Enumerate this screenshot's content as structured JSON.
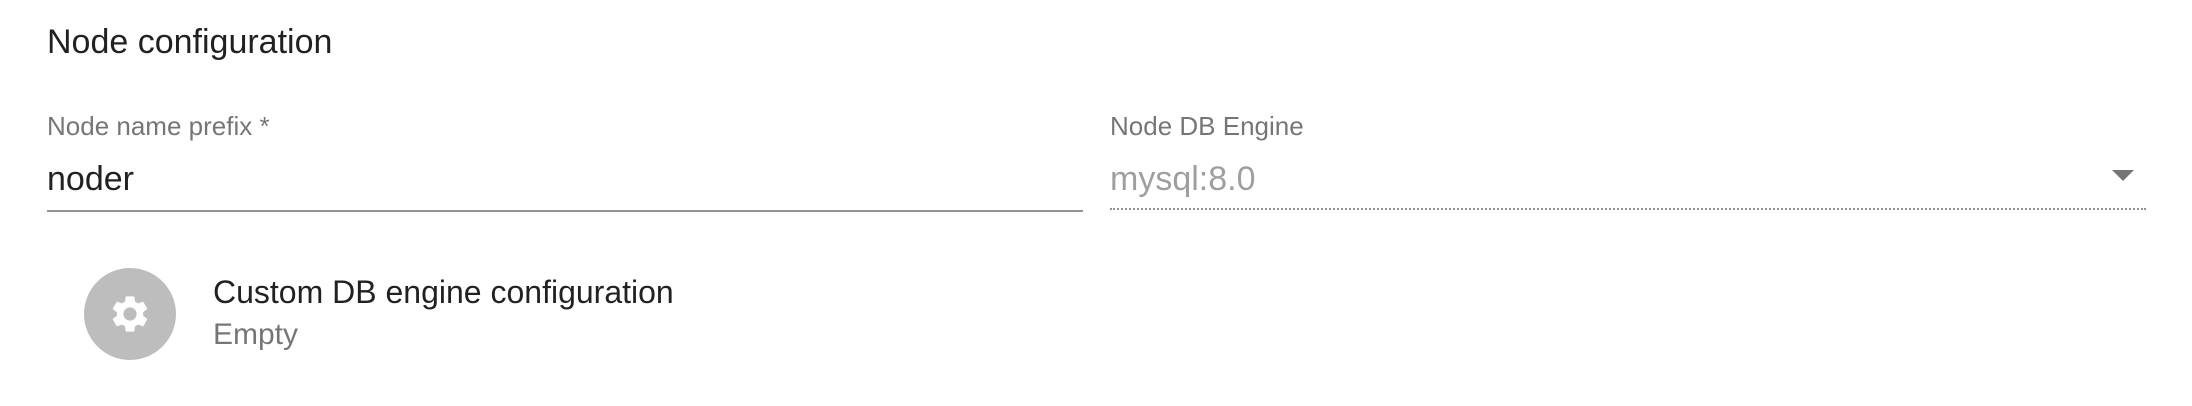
{
  "section": {
    "title": "Node configuration"
  },
  "node_name_prefix": {
    "label": "Node name prefix *",
    "value": "noder",
    "required": true
  },
  "node_db_engine": {
    "label": "Node DB Engine",
    "value": "mysql:8.0",
    "disabled": true
  },
  "custom_db_config": {
    "primary": "Custom DB engine configuration",
    "secondary": "Empty",
    "icon": "gear-icon",
    "avatar_color": "#bdbdbd"
  }
}
